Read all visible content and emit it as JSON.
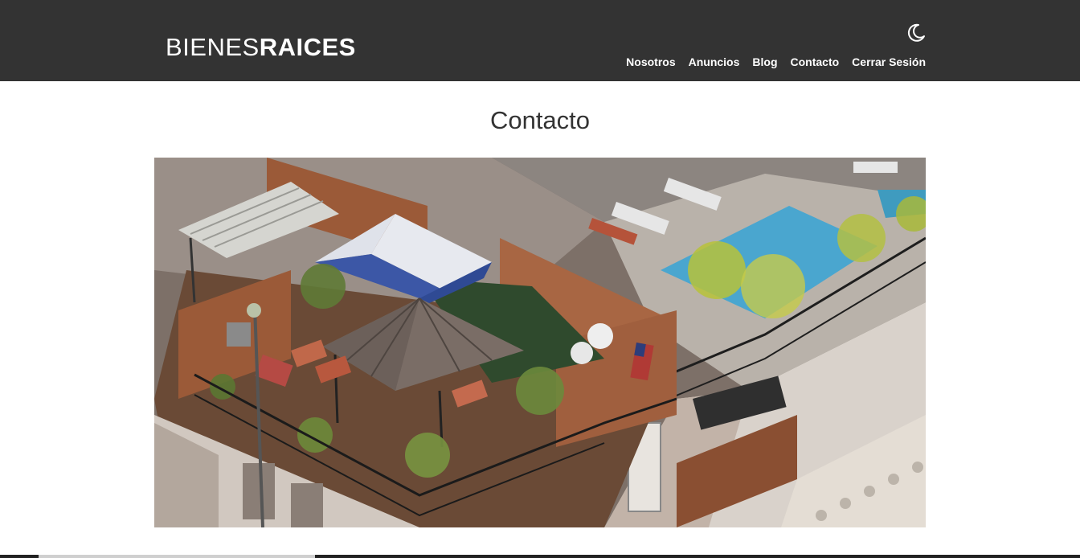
{
  "header": {
    "logo_light": "BIENES",
    "logo_bold": "RAICES",
    "theme_icon": "moon-icon",
    "nav": [
      "Nosotros",
      "Anuncios",
      "Blog",
      "Contacto",
      "Cerrar Sesión"
    ]
  },
  "main": {
    "title": "Contacto",
    "hero_image": "rooftop-terrace-photo"
  },
  "colors": {
    "header_bg": "#333333",
    "header_text": "#ffffff",
    "title_text": "#333333"
  }
}
